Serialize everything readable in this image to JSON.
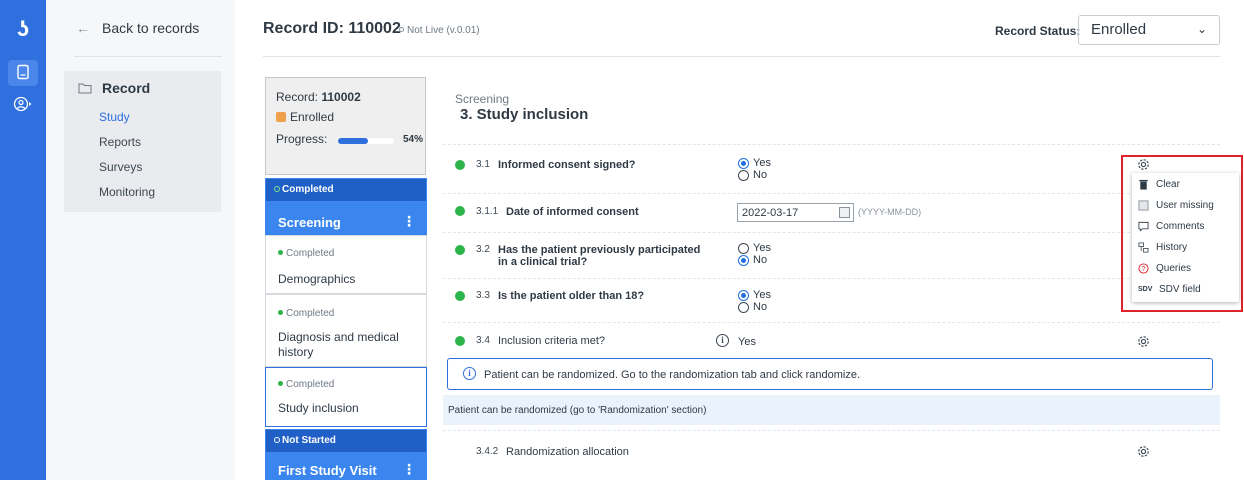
{
  "nav": {
    "back_label": "Back to records",
    "section_label": "Record",
    "items": [
      {
        "label": "Study",
        "active": true
      },
      {
        "label": "Reports",
        "active": false
      },
      {
        "label": "Surveys",
        "active": false
      },
      {
        "label": "Monitoring",
        "active": false
      }
    ]
  },
  "header": {
    "title": "Record ID: 110002",
    "live_label": "Not Live (v.0.01)",
    "status_label": "Record Status:",
    "status_value": "Enrolled"
  },
  "record_card": {
    "record_prefix": "Record: ",
    "record_id": "110002",
    "status": "Enrolled",
    "progress_label": "Progress:",
    "progress_pct": "54%",
    "progress_value": 0.54
  },
  "forms": [
    {
      "status": "Completed",
      "name": "Screening",
      "style": "blue"
    },
    {
      "status": "Completed",
      "name": "Demographics",
      "style": "white"
    },
    {
      "status": "Completed",
      "name": "Diagnosis and medical history",
      "style": "white"
    },
    {
      "status": "Completed",
      "name": "Study inclusion",
      "style": "selected"
    },
    {
      "status": "Not Started",
      "name": "First Study Visit",
      "style": "blue"
    }
  ],
  "section": {
    "subtitle": "Screening",
    "title": "3. Study inclusion"
  },
  "questions": [
    {
      "num": "3.1",
      "text": "Informed consent signed?",
      "options": [
        {
          "label": "Yes",
          "selected": true
        },
        {
          "label": "No",
          "selected": false
        }
      ]
    },
    {
      "num": "3.1.1",
      "text": "Date of informed consent",
      "value": "2022-03-17",
      "hint": "(YYYY-MM-DD)"
    },
    {
      "num": "3.2",
      "text": "Has the patient previously participated in a clinical trial?",
      "text_line1": "Has the patient previously participated",
      "text_line2": "in a clinical trial?",
      "options": [
        {
          "label": "Yes",
          "selected": false
        },
        {
          "label": "No",
          "selected": true
        }
      ]
    },
    {
      "num": "3.3",
      "text": "Is the patient older than 18?",
      "options": [
        {
          "label": "Yes",
          "selected": true
        },
        {
          "label": "No",
          "selected": false
        }
      ]
    },
    {
      "num": "3.4",
      "text": "Inclusion criteria met?",
      "value": "Yes"
    },
    {
      "num": "3.4.2",
      "text": "Randomization allocation"
    }
  ],
  "banner_text": "Patient can be randomized. Go to the randomization tab and click randomize.",
  "note_text": "Patient can be randomized (go to 'Randomization' section)",
  "field_menu": {
    "items": [
      {
        "label": "Clear",
        "icon": "trash-icon"
      },
      {
        "label": "User missing",
        "icon": "checkbox-icon"
      },
      {
        "label": "Comments",
        "icon": "comment-icon"
      },
      {
        "label": "History",
        "icon": "history-icon"
      },
      {
        "label": "Queries",
        "icon": "question-circle-icon"
      },
      {
        "label": "SDV field",
        "icon": "sdv-check-icon"
      }
    ],
    "sdv_mark": "SDV"
  },
  "colors": {
    "brand": "#2f6fde",
    "complete_green": "#2cb34a",
    "enrolled_orange": "#f0a04b",
    "highlight_red": "#e0222a"
  }
}
